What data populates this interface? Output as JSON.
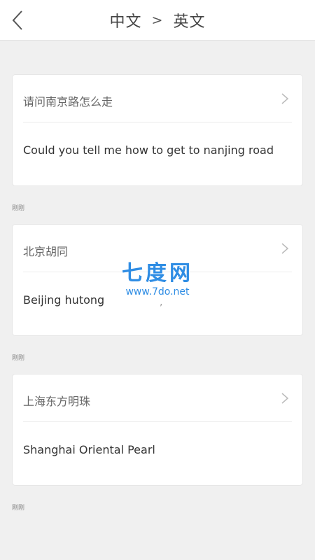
{
  "header": {
    "source_lang": "中文",
    "arrow": ">",
    "target_lang": "英文"
  },
  "items": [
    {
      "source": "请问南京路怎么走",
      "result": "Could you tell me how to get to nanjing road",
      "time": "刚刚"
    },
    {
      "source": "北京胡同",
      "result": "Beijing hutong",
      "time": "刚刚"
    },
    {
      "source": "上海东方明珠",
      "result": "Shanghai Oriental Pearl",
      "time": "刚刚"
    }
  ],
  "watermark": {
    "brand": "七度网",
    "url": "www.7do.net"
  },
  "stray_mark": ","
}
